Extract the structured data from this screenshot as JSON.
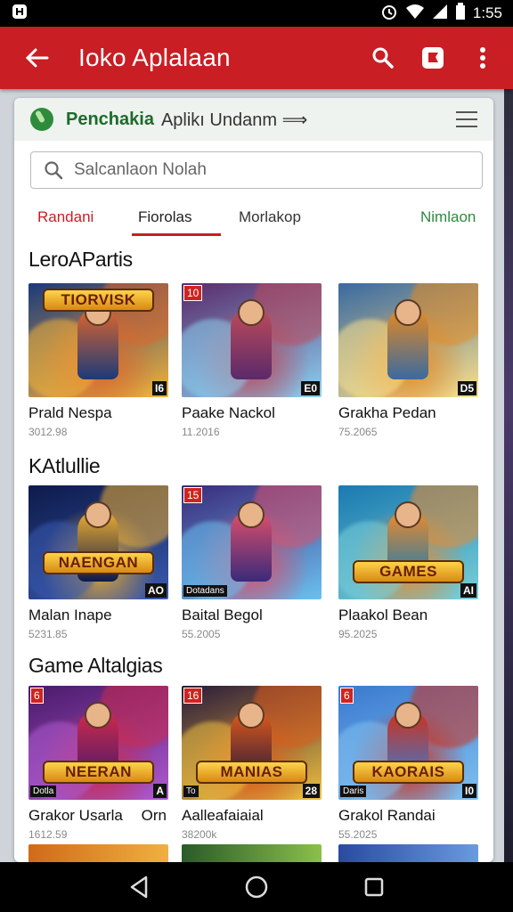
{
  "status_bar": {
    "time": "1:55"
  },
  "app_bar": {
    "title": "Ioko Aplalaan",
    "icons": [
      "back-arrow-icon",
      "search-icon",
      "store-bag-icon",
      "more-vert-icon"
    ]
  },
  "banner": {
    "strong": "Penchakia",
    "rest": "Aplikı Undanm ⟹",
    "icon": "leaf-icon"
  },
  "search": {
    "placeholder": "Salcanlaon Nolah"
  },
  "tabs": [
    {
      "label": "Randani",
      "color": "#c81e24"
    },
    {
      "label": "Fiorolas",
      "color": "#222222"
    },
    {
      "label": "Morlakop",
      "color": "#333333"
    },
    {
      "label": "Nimlaon",
      "color": "#2e8b3c"
    }
  ],
  "sections": [
    {
      "title": "LeroAPartis",
      "items": [
        {
          "name": "Prald Nespa",
          "meta": "3012.98",
          "badge_tl": "",
          "badge_br": "I6",
          "badge_bl": "",
          "logo": "TIORVISK",
          "colors": [
            "#1b3a7a",
            "#e0662a",
            "#f4b23a"
          ]
        },
        {
          "name": "Paake Nackol",
          "meta": "11.2016",
          "badge_tl": "10",
          "badge_br": "E0",
          "badge_bl": "",
          "logo": "",
          "colors": [
            "#5a2a6a",
            "#c04a5a",
            "#8ad0f0"
          ]
        },
        {
          "name": "Grakha Pedan",
          "meta": "75.2065",
          "badge_tl": "",
          "badge_br": "D5",
          "badge_bl": "",
          "logo": "",
          "colors": [
            "#3a6aa0",
            "#e88a20",
            "#fce08a"
          ]
        }
      ]
    },
    {
      "title": "KAtlullie",
      "items": [
        {
          "name": "Malan Inape",
          "meta": "5231.85",
          "badge_tl": "",
          "badge_br": "AO",
          "badge_bl": "",
          "logo": "NAENGAN",
          "colors": [
            "#0d1a4a",
            "#f0b030",
            "#3a5ab0"
          ]
        },
        {
          "name": "Baital Begol",
          "meta": "55.2005",
          "badge_tl": "15",
          "badge_br": "",
          "badge_bl": "Dotadans",
          "logo": "",
          "colors": [
            "#3a2a7a",
            "#e0506a",
            "#6ac0f0"
          ]
        },
        {
          "name": "Plaakol Bean",
          "meta": "95.2025",
          "badge_tl": "",
          "badge_br": "AI",
          "badge_bl": "",
          "logo": "GAMES",
          "colors": [
            "#1a7ab0",
            "#f08a2a",
            "#7ad0d8"
          ]
        }
      ]
    },
    {
      "title": "Game Altalgias",
      "items": [
        {
          "name": "Grakor Usarla",
          "name_right": "Orn",
          "meta": "1612.59",
          "badge_tl": "6",
          "badge_br": "A",
          "badge_bl": "Dotla",
          "logo": "NEERAN",
          "colors": [
            "#4a1a6a",
            "#d02a4a",
            "#b05ad0"
          ]
        },
        {
          "name": "Aalleafaiaial",
          "meta": "38200k",
          "badge_tl": "16",
          "badge_br": "28",
          "badge_bl": "To",
          "logo": "MANIAS",
          "colors": [
            "#2a1a3a",
            "#e05a1a",
            "#f0c040"
          ]
        },
        {
          "name": "Grakol Randai",
          "meta": "55.2025",
          "badge_tl": "6",
          "badge_br": "I0",
          "badge_bl": "Daris",
          "logo": "KAORAIS",
          "colors": [
            "#3a7ad0",
            "#d0301a",
            "#80c0f0"
          ]
        }
      ]
    }
  ],
  "colors": {
    "accent": "#c81e24",
    "green": "#2e8b3c"
  }
}
